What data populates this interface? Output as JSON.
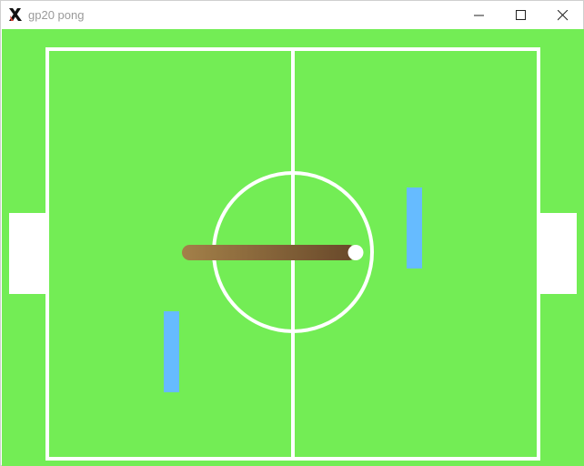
{
  "window": {
    "title": "gp20 pong",
    "app_icon": "x-logo-icon",
    "controls": {
      "minimize_icon": "minimize-icon",
      "maximize_icon": "maximize-icon",
      "close_icon": "close-icon"
    }
  },
  "game": {
    "field_color": "#73ed55",
    "line_color": "#ffffff",
    "goal_color": "#ffffff",
    "paddle_color": "#66bbff",
    "ball_color": "#ffffff",
    "trail_color_start": "#a07e48",
    "trail_color_end": "#6a4a26"
  }
}
